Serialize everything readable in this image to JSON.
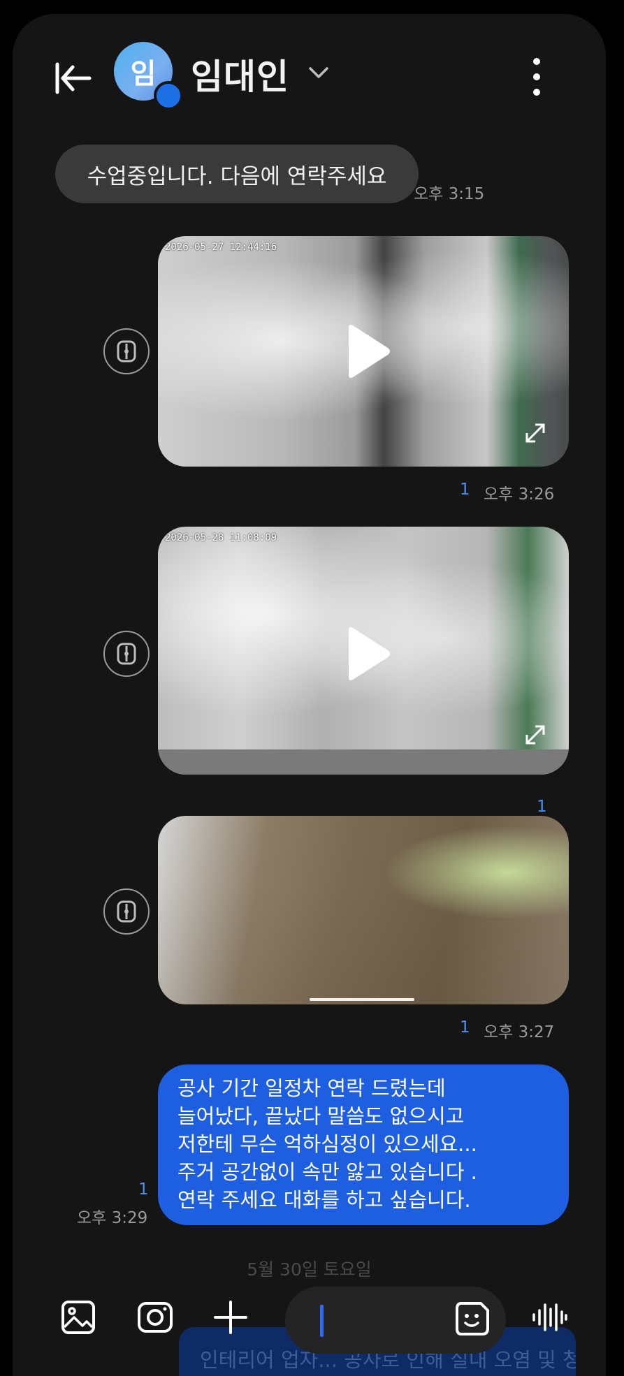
{
  "header": {
    "avatar_initial": "임",
    "contact_name": "임대인"
  },
  "messages": {
    "incoming_1": {
      "text": "수업중입니다. 다음에 연락주세요",
      "time": "오후 3:15"
    },
    "video_1": {
      "timestamp_overlay": "2026-05-27 12:44:16",
      "unread_count": "1",
      "time": "오후 3:26"
    },
    "video_2": {
      "timestamp_overlay": "2026-05-28 11:08:09",
      "unread_count": "1"
    },
    "image_3": {
      "unread_count": "1",
      "time": "오후 3:27"
    },
    "outgoing_1": {
      "lines": [
        "공사 기간 일정차 연락 드렸는데",
        "늘어났다, 끝났다 말씀도 없으시고",
        "저한테 무슨 억하심정이 있으세요...",
        "주거 공간없이 속만 앓고 있습니다 .",
        "연락 주세요 대화를 하고 싶습니다."
      ],
      "unread_count": "1",
      "time": "오후 3:29"
    }
  },
  "date_separator": "5월 30일 토요일",
  "draft_preview": "인테리어 업자... 공사로 인해 실내 오염 및 청소 필요...",
  "colors": {
    "accent": "#1d5fe0",
    "incoming_bubble": "#3a3a3a",
    "background": "#151515",
    "unread": "#4c8ff0"
  }
}
